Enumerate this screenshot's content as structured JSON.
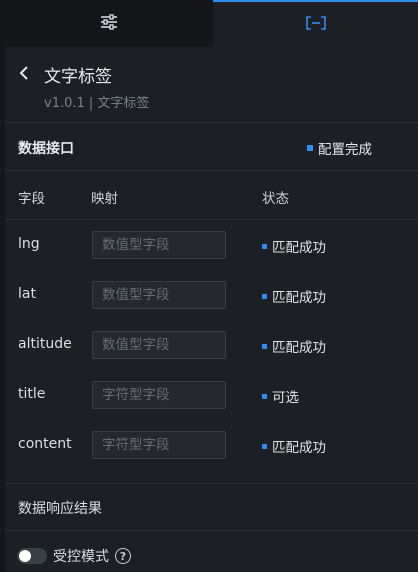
{
  "tabs": [
    {
      "icon": "sliders-icon",
      "active": false
    },
    {
      "icon": "bracket-data-icon",
      "active": true
    }
  ],
  "header": {
    "back_icon": "chevron-left-icon",
    "title": "文字标签",
    "subtitle": "v1.0.1 | 文字标签"
  },
  "data_interface": {
    "title": "数据接口",
    "status": "配置完成"
  },
  "columns": {
    "field": "字段",
    "mapping": "映射",
    "status": "状态"
  },
  "fields": [
    {
      "name": "lng",
      "placeholder": "数值型字段",
      "value": "",
      "status": "匹配成功"
    },
    {
      "name": "lat",
      "placeholder": "数值型字段",
      "value": "",
      "status": "匹配成功"
    },
    {
      "name": "altitude",
      "placeholder": "数值型字段",
      "value": "",
      "status": "匹配成功"
    },
    {
      "name": "title",
      "placeholder": "字符型字段",
      "value": "",
      "status": "可选"
    },
    {
      "name": "content",
      "placeholder": "字符型字段",
      "value": "",
      "status": "匹配成功"
    }
  ],
  "response": {
    "title": "数据响应结果"
  },
  "controlled_mode": {
    "label": "受控模式",
    "enabled": false,
    "help_glyph": "?"
  },
  "colors": {
    "accent": "#2f8cf0",
    "background": "#1c1f23",
    "tab_inactive_bg": "#14161a"
  }
}
